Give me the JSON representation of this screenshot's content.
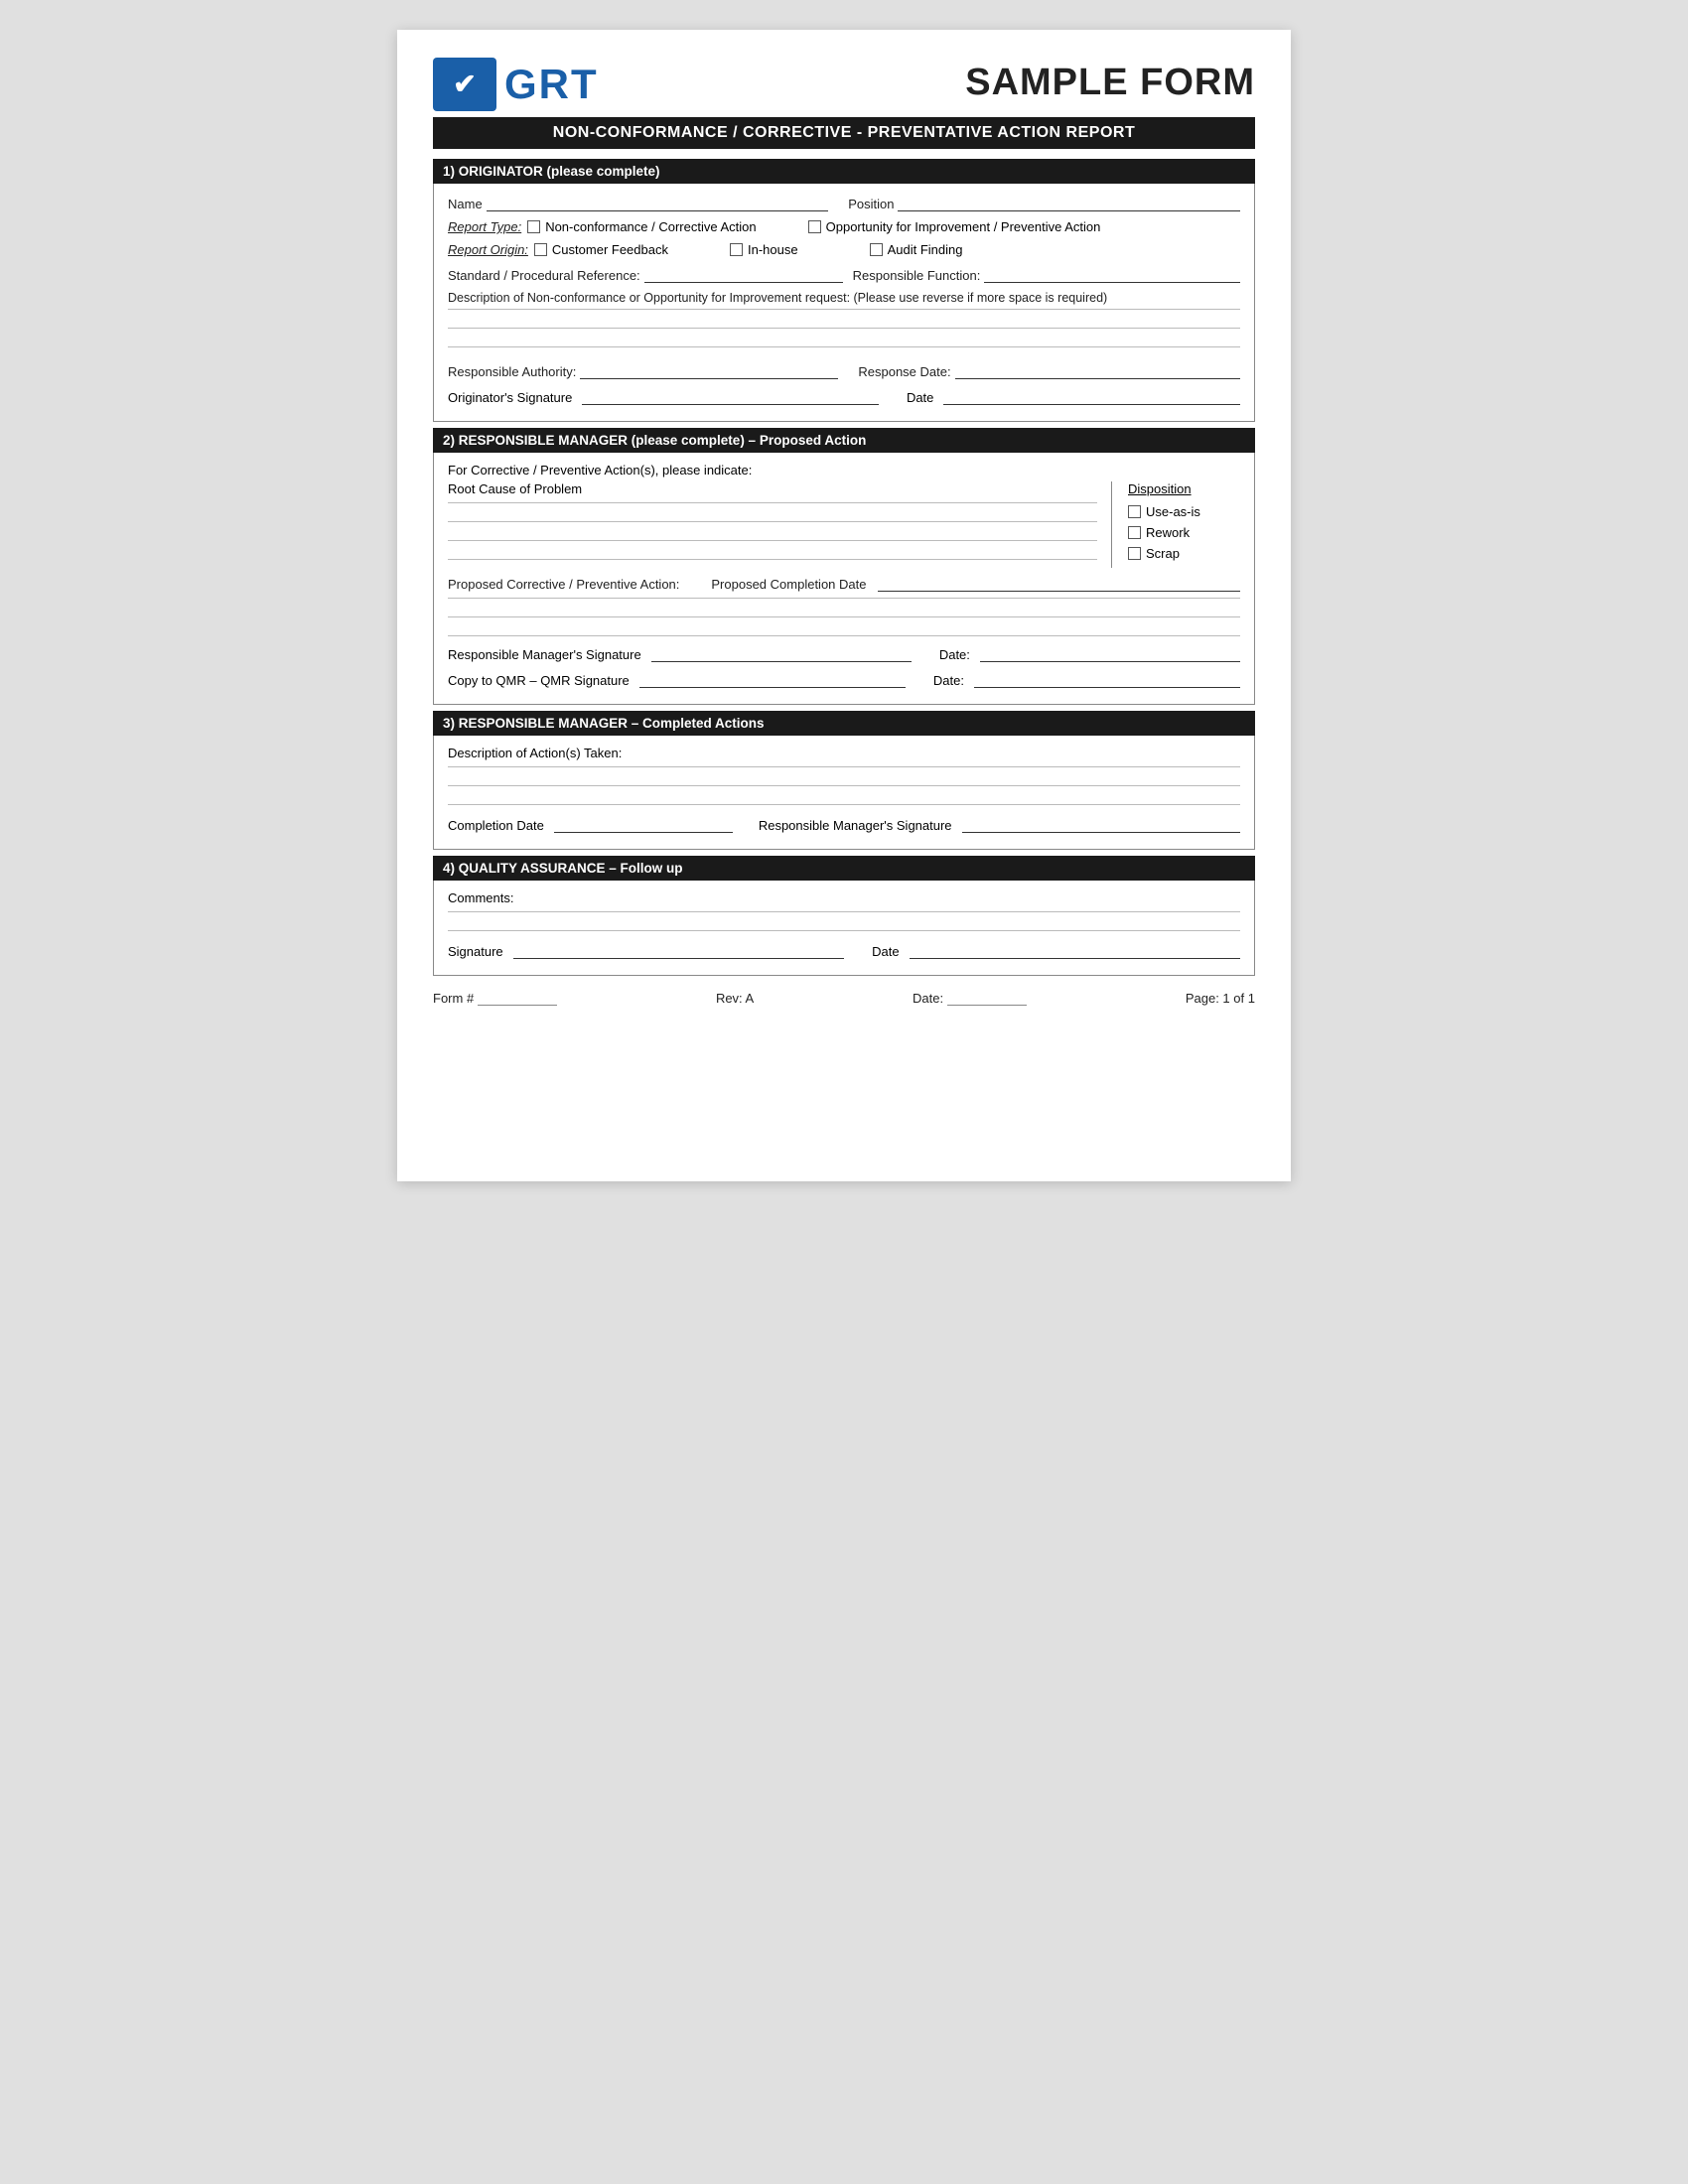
{
  "header": {
    "logo_text": "GRT",
    "sample_form": "SAMPLE FORM",
    "main_title": "NON-CONFORMANCE / CORRECTIVE - PREVENTATIVE ACTION REPORT"
  },
  "section1": {
    "header": "1) ORIGINATOR (please complete)",
    "name_label": "Name",
    "position_label": "Position",
    "report_type_label": "Report Type:",
    "report_type_options": [
      "Non-conformance / Corrective Action",
      "Opportunity for Improvement / Preventive Action"
    ],
    "report_origin_label": "Report Origin:",
    "report_origin_options": [
      "Customer Feedback",
      "In-house",
      "Audit Finding"
    ],
    "std_ref_label": "Standard / Procedural Reference:",
    "resp_function_label": "Responsible Function:",
    "description_label": "Description of Non-conformance or Opportunity for Improvement request: (Please use reverse if more space is required)",
    "resp_authority_label": "Responsible Authority:",
    "response_date_label": "Response Date:",
    "orig_sig_label": "Originator's Signature",
    "date_label": "Date"
  },
  "section2": {
    "header": "2) RESPONSIBLE MANAGER (please complete) – Proposed Action",
    "for_corrective_label": "For Corrective / Preventive Action(s), please indicate:",
    "root_cause_label": "Root Cause of Problem",
    "disposition_label": "Disposition",
    "disposition_options": [
      "Use-as-is",
      "Rework",
      "Scrap"
    ],
    "proposed_action_label": "Proposed Corrective / Preventive Action:",
    "proposed_completion_label": "Proposed Completion Date",
    "resp_mgr_sig_label": "Responsible Manager's Signature",
    "date_label": "Date:",
    "copy_qmr_label": "Copy to QMR – QMR Signature",
    "date2_label": "Date:"
  },
  "section3": {
    "header": "3) RESPONSIBLE MANAGER – Completed Actions",
    "desc_actions_label": "Description of Action(s) Taken:",
    "completion_date_label": "Completion Date",
    "resp_mgr_sig_label": "Responsible Manager's Signature"
  },
  "section4": {
    "header": "4) QUALITY ASSURANCE – Follow up",
    "comments_label": "Comments:",
    "signature_label": "Signature",
    "date_label": "Date"
  },
  "footer": {
    "form_label": "Form #",
    "rev_label": "Rev: A",
    "date_label": "Date:",
    "page_label": "Page: 1 of 1"
  }
}
